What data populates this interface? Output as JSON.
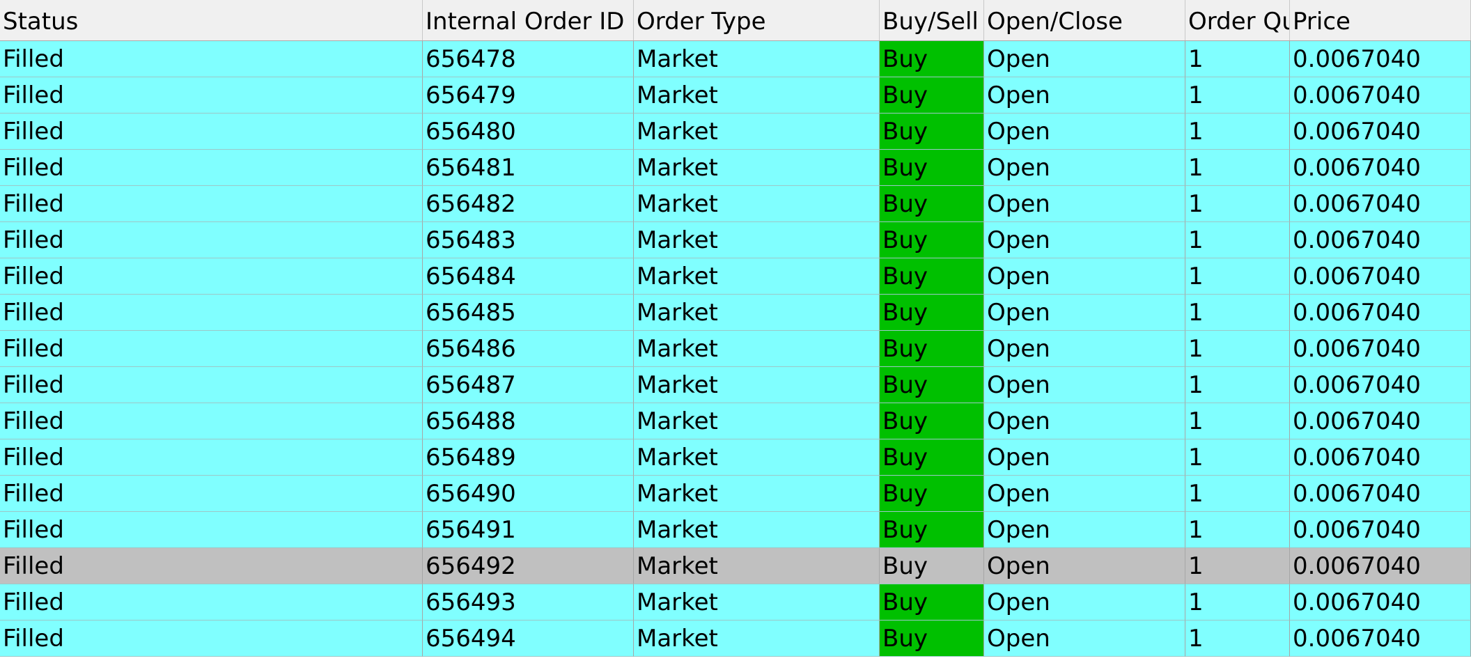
{
  "colors": {
    "row_background": "#80ffff",
    "selected_row_background": "#c0c0c0",
    "buy_cell_background": "#00c000",
    "header_background": "#f0f0f0"
  },
  "table": {
    "headers": [
      "Status",
      "Internal Order ID",
      "Order Type",
      "Buy/Sell",
      "Open/Close",
      "Order Qu",
      "Price"
    ],
    "rows": [
      {
        "status": "Filled",
        "internal_order_id": "656478",
        "order_type": "Market",
        "buy_sell": "Buy",
        "open_close": "Open",
        "order_qty": "1",
        "price": "0.0067040",
        "selected": false
      },
      {
        "status": "Filled",
        "internal_order_id": "656479",
        "order_type": "Market",
        "buy_sell": "Buy",
        "open_close": "Open",
        "order_qty": "1",
        "price": "0.0067040",
        "selected": false
      },
      {
        "status": "Filled",
        "internal_order_id": "656480",
        "order_type": "Market",
        "buy_sell": "Buy",
        "open_close": "Open",
        "order_qty": "1",
        "price": "0.0067040",
        "selected": false
      },
      {
        "status": "Filled",
        "internal_order_id": "656481",
        "order_type": "Market",
        "buy_sell": "Buy",
        "open_close": "Open",
        "order_qty": "1",
        "price": "0.0067040",
        "selected": false
      },
      {
        "status": "Filled",
        "internal_order_id": "656482",
        "order_type": "Market",
        "buy_sell": "Buy",
        "open_close": "Open",
        "order_qty": "1",
        "price": "0.0067040",
        "selected": false
      },
      {
        "status": "Filled",
        "internal_order_id": "656483",
        "order_type": "Market",
        "buy_sell": "Buy",
        "open_close": "Open",
        "order_qty": "1",
        "price": "0.0067040",
        "selected": false
      },
      {
        "status": "Filled",
        "internal_order_id": "656484",
        "order_type": "Market",
        "buy_sell": "Buy",
        "open_close": "Open",
        "order_qty": "1",
        "price": "0.0067040",
        "selected": false
      },
      {
        "status": "Filled",
        "internal_order_id": "656485",
        "order_type": "Market",
        "buy_sell": "Buy",
        "open_close": "Open",
        "order_qty": "1",
        "price": "0.0067040",
        "selected": false
      },
      {
        "status": "Filled",
        "internal_order_id": "656486",
        "order_type": "Market",
        "buy_sell": "Buy",
        "open_close": "Open",
        "order_qty": "1",
        "price": "0.0067040",
        "selected": false
      },
      {
        "status": "Filled",
        "internal_order_id": "656487",
        "order_type": "Market",
        "buy_sell": "Buy",
        "open_close": "Open",
        "order_qty": "1",
        "price": "0.0067040",
        "selected": false
      },
      {
        "status": "Filled",
        "internal_order_id": "656488",
        "order_type": "Market",
        "buy_sell": "Buy",
        "open_close": "Open",
        "order_qty": "1",
        "price": "0.0067040",
        "selected": false
      },
      {
        "status": "Filled",
        "internal_order_id": "656489",
        "order_type": "Market",
        "buy_sell": "Buy",
        "open_close": "Open",
        "order_qty": "1",
        "price": "0.0067040",
        "selected": false
      },
      {
        "status": "Filled",
        "internal_order_id": "656490",
        "order_type": "Market",
        "buy_sell": "Buy",
        "open_close": "Open",
        "order_qty": "1",
        "price": "0.0067040",
        "selected": false
      },
      {
        "status": "Filled",
        "internal_order_id": "656491",
        "order_type": "Market",
        "buy_sell": "Buy",
        "open_close": "Open",
        "order_qty": "1",
        "price": "0.0067040",
        "selected": false
      },
      {
        "status": "Filled",
        "internal_order_id": "656492",
        "order_type": "Market",
        "buy_sell": "Buy",
        "open_close": "Open",
        "order_qty": "1",
        "price": "0.0067040",
        "selected": true
      },
      {
        "status": "Filled",
        "internal_order_id": "656493",
        "order_type": "Market",
        "buy_sell": "Buy",
        "open_close": "Open",
        "order_qty": "1",
        "price": "0.0067040",
        "selected": false
      },
      {
        "status": "Filled",
        "internal_order_id": "656494",
        "order_type": "Market",
        "buy_sell": "Buy",
        "open_close": "Open",
        "order_qty": "1",
        "price": "0.0067040",
        "selected": false
      }
    ]
  }
}
